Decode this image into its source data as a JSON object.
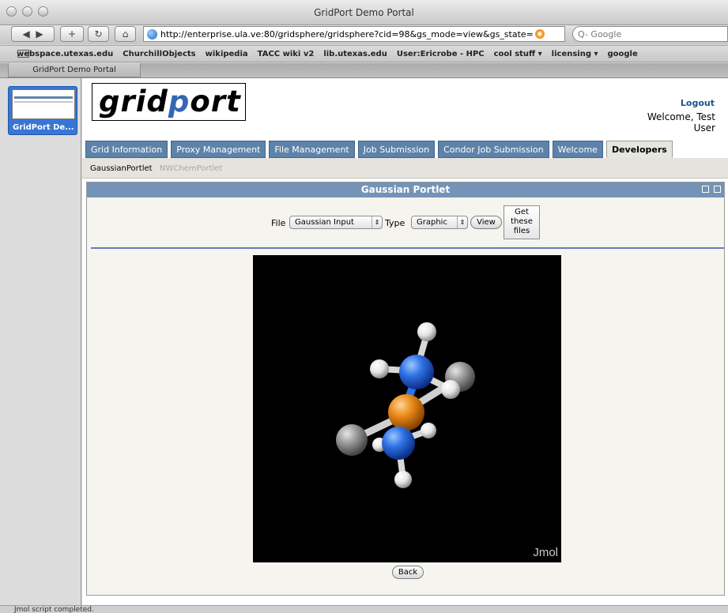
{
  "window": {
    "title": "GridPort Demo Portal"
  },
  "toolbar": {
    "back_icon": "back-arrow-icon",
    "add_label": "+",
    "reload_icon": "reload-icon",
    "home_icon": "home-icon",
    "url": "http://enterprise.ula.ve:80/gridsphere/gridsphere?cid=98&gs_mode=view&gs_state=",
    "search_placeholder": "Q- Google"
  },
  "bookmarks": [
    "webspace.utexas.edu",
    "ChurchillObjects",
    "wikipedia",
    "TACC wiki v2",
    "lib.utexas.edu",
    "User:Ericrobe - HPC",
    "cool stuff ▾",
    "licensing ▾",
    "google"
  ],
  "tab": {
    "title": "GridPort Demo Portal"
  },
  "drawer": {
    "thumbnail_label": "GridPort De..."
  },
  "header": {
    "logo_a": "grid",
    "logo_b": "p",
    "logo_c": "ort",
    "logout": "Logout",
    "welcome": "Welcome, Test User"
  },
  "tabs": [
    "Grid Information",
    "Proxy Management",
    "File Management",
    "Job Submission",
    "Condor Job Submission",
    "Welcome",
    "Developers"
  ],
  "active_tab": "Developers",
  "subtabs": {
    "gaussian": "GaussianPortlet",
    "nwchem": "NWChemPortlet"
  },
  "portlet": {
    "title": "Gaussian Portlet",
    "file_label": "File",
    "file_value": "Gaussian Input",
    "type_label": "Type",
    "type_value": "Graphic",
    "view_button": "View",
    "get_files_button": "Get these files",
    "viewer_watermark": "Jmol",
    "back_button": "Back"
  },
  "status": "Jmol script completed.",
  "colors": {
    "portal_blue": "#5e83aa",
    "panel_head": "#7493b6",
    "rule": "#5b81b9",
    "logout": "#1d5290"
  }
}
